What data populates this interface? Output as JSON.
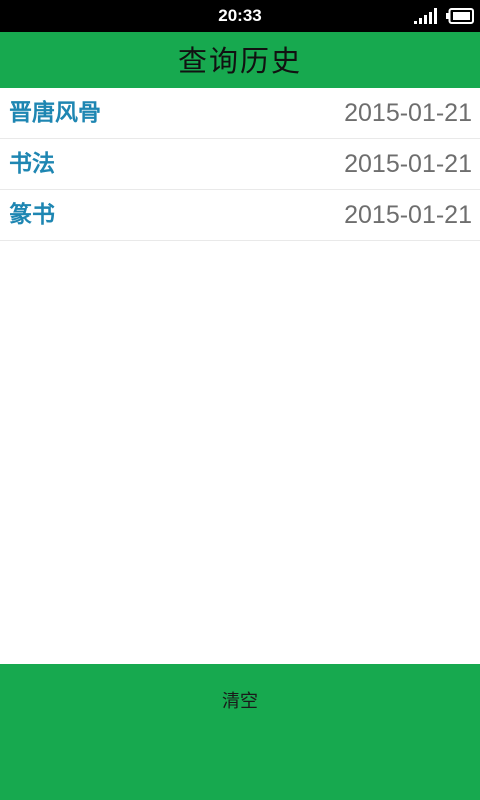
{
  "status_bar": {
    "time": "20:33",
    "icons": [
      "signal-icon",
      "battery-icon"
    ]
  },
  "header": {
    "title": "查询历史"
  },
  "history": {
    "items": [
      {
        "query": "晋唐风骨",
        "date": "2015-01-21"
      },
      {
        "query": "书法",
        "date": "2015-01-21"
      },
      {
        "query": "篆书",
        "date": "2015-01-21"
      }
    ]
  },
  "footer": {
    "clear_label": "清空"
  },
  "colors": {
    "accent": "#17a94f",
    "item_text": "#1e86b2",
    "date_text": "#6e6e6e",
    "status_bar": "#000000"
  }
}
